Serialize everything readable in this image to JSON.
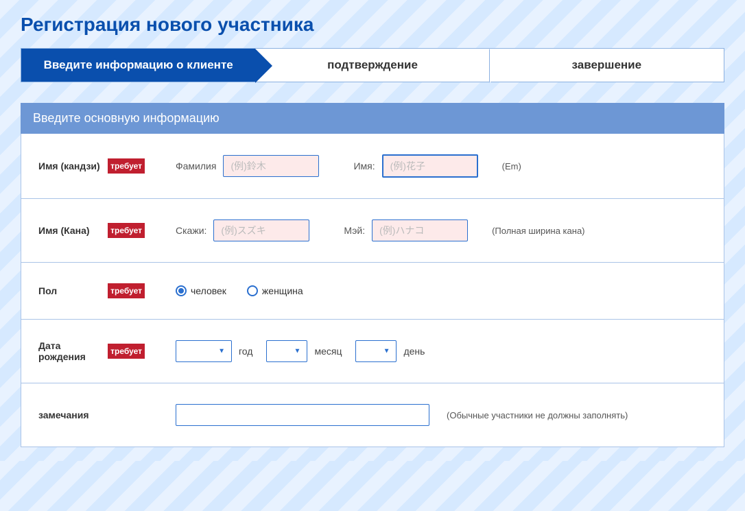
{
  "page_title": "Регистрация нового участника",
  "steps": {
    "step1": "Введите информацию о клиенте",
    "step2": "подтверждение",
    "step3": "завершение"
  },
  "section_header": "Введите основную информацию",
  "required_label": "требует",
  "fields": {
    "kanji": {
      "label": "Имя (кандзи)",
      "surname_label": "Фамилия",
      "surname_placeholder": "(例)鈴木",
      "name_label": "Имя:",
      "name_placeholder": "(例)花子",
      "hint": "(Em)"
    },
    "kana": {
      "label": "Имя (Кана)",
      "surname_label": "Скажи:",
      "surname_placeholder": "(例)スズキ",
      "name_label": "Мэй:",
      "name_placeholder": "(例)ハナコ",
      "hint": "(Полная ширина кана)"
    },
    "gender": {
      "label": "Пол",
      "male": "человек",
      "female": "женщина"
    },
    "birth": {
      "label": "Дата рождения",
      "year": "год",
      "month": "месяц",
      "day": "день"
    },
    "notes": {
      "label": "замечания",
      "hint": "(Обычные участники не должны заполнять)"
    }
  }
}
